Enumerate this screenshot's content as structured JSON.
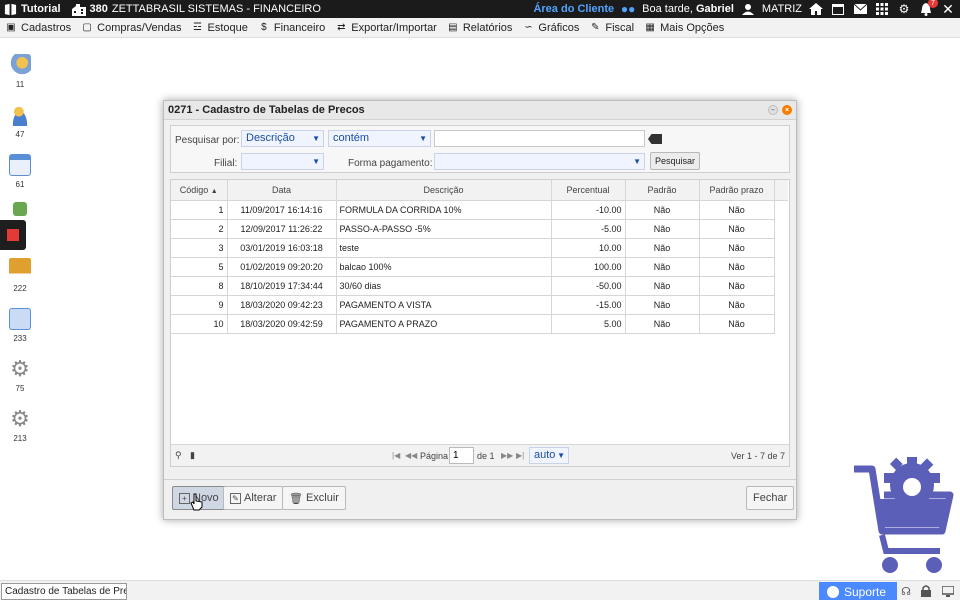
{
  "topbar": {
    "app_name": "Tutorial",
    "company_code": "380",
    "company_name": "ZETTABRASIL SISTEMAS - FINANCEIRO",
    "client_area": "Área do Cliente",
    "greeting_prefix": "Boa tarde,",
    "user_name": "Gabriel",
    "branch": "MATRIZ",
    "notification_count": "7"
  },
  "menu": [
    {
      "label": "Cadastros",
      "icon": "id-card-icon"
    },
    {
      "label": "Compras/Vendas",
      "icon": "shopping-bag-icon"
    },
    {
      "label": "Estoque",
      "icon": "database-icon"
    },
    {
      "label": "Financeiro",
      "icon": "dollar-icon"
    },
    {
      "label": "Exportar/Importar",
      "icon": "arrows-icon"
    },
    {
      "label": "Relatórios",
      "icon": "document-icon"
    },
    {
      "label": "Gráficos",
      "icon": "chart-line-icon"
    },
    {
      "label": "Fiscal",
      "icon": "edit-icon"
    },
    {
      "label": "Mais Opções",
      "icon": "grid-icon"
    }
  ],
  "sidebar": [
    {
      "count": "11",
      "icon": "user-gear-icon"
    },
    {
      "count": "47",
      "icon": "user-icon"
    },
    {
      "count": "61",
      "icon": "window-add-icon"
    },
    {
      "count": "",
      "icon": "box-arrow-icon"
    },
    {
      "count": "222",
      "icon": "truck-icon"
    },
    {
      "count": "233",
      "icon": "documents-icon"
    },
    {
      "count": "75",
      "icon": "gear-icon"
    },
    {
      "count": "213",
      "icon": "gear-icon"
    }
  ],
  "modal": {
    "title": "0271 - Cadastro de Tabelas de Precos",
    "filter": {
      "search_by_label": "Pesquisar por:",
      "field_value": "Descrição",
      "operator_value": "contém",
      "search_value": "",
      "filial_label": "Filial:",
      "filial_value": "",
      "payment_label": "Forma pagamento:",
      "payment_value": "",
      "search_button": "Pesquisar"
    },
    "columns": [
      "Código",
      "Data",
      "Descrição",
      "Percentual",
      "Padrão",
      "Padrão prazo"
    ],
    "rows": [
      {
        "codigo": "1",
        "data": "11/09/2017 16:14:16",
        "descricao": "FORMULA DA CORRIDA 10%",
        "percentual": "-10.00",
        "padrao": "Não",
        "padrao_prazo": "Não"
      },
      {
        "codigo": "2",
        "data": "12/09/2017 11:26:22",
        "descricao": "PASSO-A-PASSO -5%",
        "percentual": "-5.00",
        "padrao": "Não",
        "padrao_prazo": "Não"
      },
      {
        "codigo": "3",
        "data": "03/01/2019 16:03:18",
        "descricao": "teste",
        "percentual": "10.00",
        "padrao": "Não",
        "padrao_prazo": "Não"
      },
      {
        "codigo": "5",
        "data": "01/02/2019 09:20:20",
        "descricao": "balcao 100%",
        "percentual": "100.00",
        "padrao": "Não",
        "padrao_prazo": "Não"
      },
      {
        "codigo": "8",
        "data": "18/10/2019 17:34:44",
        "descricao": "30/60 dias",
        "percentual": "-50.00",
        "padrao": "Não",
        "padrao_prazo": "Não"
      },
      {
        "codigo": "9",
        "data": "18/03/2020 09:42:23",
        "descricao": "PAGAMENTO A VISTA",
        "percentual": "-15.00",
        "padrao": "Não",
        "padrao_prazo": "Não"
      },
      {
        "codigo": "10",
        "data": "18/03/2020 09:42:59",
        "descricao": "PAGAMENTO A PRAZO",
        "percentual": "5.00",
        "padrao": "Não",
        "padrao_prazo": "Não"
      }
    ],
    "pager": {
      "page_label": "Página",
      "page_value": "1",
      "of_label": "de 1",
      "page_size": "auto",
      "summary": "Ver 1 - 7 de 7"
    },
    "buttons": {
      "novo": "Novo",
      "alterar": "Alterar",
      "excluir": "Excluir",
      "fechar": "Fechar"
    }
  },
  "bottombar": {
    "task_tab": "Cadastro de Tabelas de Precos",
    "support": "Suporte"
  },
  "colors": {
    "topbar": "#1b1b1b",
    "client_area": "#4fa3ff",
    "support": "#4a89ff",
    "cart_logo": "#5c5fb8",
    "close_button": "#f57c00"
  }
}
